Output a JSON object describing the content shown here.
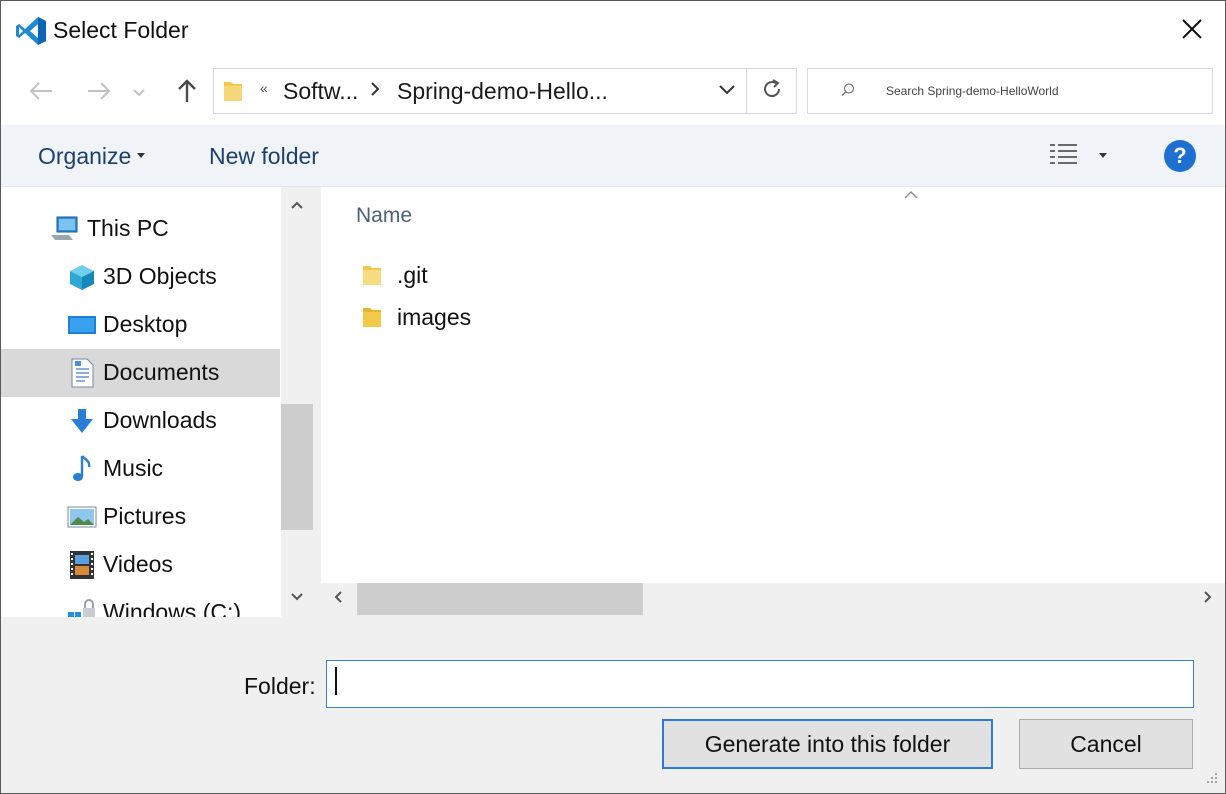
{
  "window": {
    "title": "Select Folder",
    "app_icon": "vscode-icon",
    "close_icon": "close-icon"
  },
  "nav": {
    "back_icon": "back-arrow-icon",
    "forward_icon": "forward-arrow-icon",
    "recent_icon": "chevron-down-icon",
    "up_icon": "up-arrow-icon"
  },
  "address": {
    "overflow_marker": "«",
    "crumbs": [
      "Softw...",
      "Spring-demo-Hello..."
    ],
    "refresh_icon": "refresh-icon"
  },
  "search": {
    "placeholder": "Search Spring-demo-HelloWorld"
  },
  "toolbar": {
    "organize_label": "Organize",
    "new_folder_label": "New folder",
    "view_icon": "details-view-icon",
    "help_label": "?"
  },
  "tree": {
    "items": [
      {
        "label": "This PC",
        "icon": "this-pc-icon"
      },
      {
        "label": "3D Objects",
        "icon": "3d-objects-icon"
      },
      {
        "label": "Desktop",
        "icon": "desktop-icon"
      },
      {
        "label": "Documents",
        "icon": "documents-icon",
        "selected": true
      },
      {
        "label": "Downloads",
        "icon": "downloads-icon"
      },
      {
        "label": "Music",
        "icon": "music-icon"
      },
      {
        "label": "Pictures",
        "icon": "pictures-icon"
      },
      {
        "label": "Videos",
        "icon": "videos-icon"
      },
      {
        "label": "Windows (C:)",
        "icon": "windows-drive-icon"
      }
    ]
  },
  "files": {
    "column_header": "Name",
    "items": [
      {
        "name": ".git",
        "icon": "folder-icon"
      },
      {
        "name": "images",
        "icon": "folder-icon"
      }
    ]
  },
  "bottom": {
    "folder_label": "Folder:",
    "folder_value": "",
    "generate_label": "Generate into this folder",
    "cancel_label": "Cancel"
  },
  "colors": {
    "accent": "#2b7cd3",
    "toolbar_text": "#1e3f6b",
    "selected_bg": "#d9d9d9",
    "folder_yellow": "#f3c94a"
  }
}
